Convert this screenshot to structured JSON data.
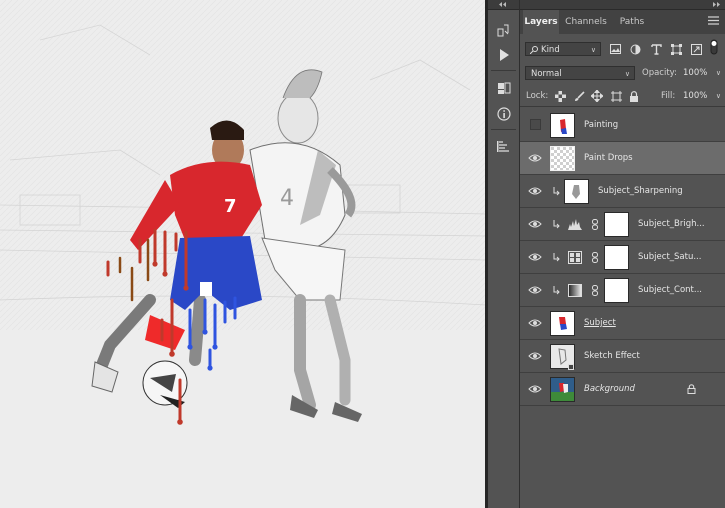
{
  "tabs": [
    {
      "label": "Layers",
      "active": true
    },
    {
      "label": "Channels",
      "active": false
    },
    {
      "label": "Paths",
      "active": false
    }
  ],
  "filter": {
    "kind_label": "Kind"
  },
  "blend": {
    "mode": "Normal",
    "opacity_label": "Opacity:",
    "opacity_value": "100%"
  },
  "lock": {
    "label": "Lock:",
    "fill_label": "Fill:",
    "fill_value": "100%"
  },
  "layers": [
    {
      "name": "Painting",
      "visible": false,
      "thumb": "painting",
      "clipped": false
    },
    {
      "name": "Paint Drops",
      "visible": true,
      "thumb": "transparent",
      "clipped": false,
      "selected": true
    },
    {
      "name": "Subject_Sharpening",
      "visible": true,
      "thumb": "subject-gray",
      "clipped": true
    },
    {
      "name": "Subject_Brigh...",
      "visible": true,
      "adjustment": "levels-icon",
      "clipped": true,
      "has_mask": true
    },
    {
      "name": "Subject_Satu...",
      "visible": true,
      "adjustment": "hue-saturation-icon",
      "clipped": true,
      "has_mask": true
    },
    {
      "name": "Subject_Cont...",
      "visible": true,
      "adjustment": "gradient-map-icon",
      "clipped": true,
      "has_mask": true
    },
    {
      "name": "Subject",
      "visible": true,
      "thumb": "subject-color",
      "clipped": false,
      "underlined": true
    },
    {
      "name": "Sketch Effect",
      "visible": true,
      "thumb": "sketch",
      "clipped": false
    },
    {
      "name": "Background",
      "visible": true,
      "thumb": "photo",
      "clipped": false,
      "italic": true,
      "locked": true
    }
  ],
  "colors": {
    "panel": "#535353",
    "selected_row": "#6c6c6c",
    "canvas": "#ececec",
    "jersey_red": "#d8272d",
    "shorts_blue": "#2a48c7"
  }
}
